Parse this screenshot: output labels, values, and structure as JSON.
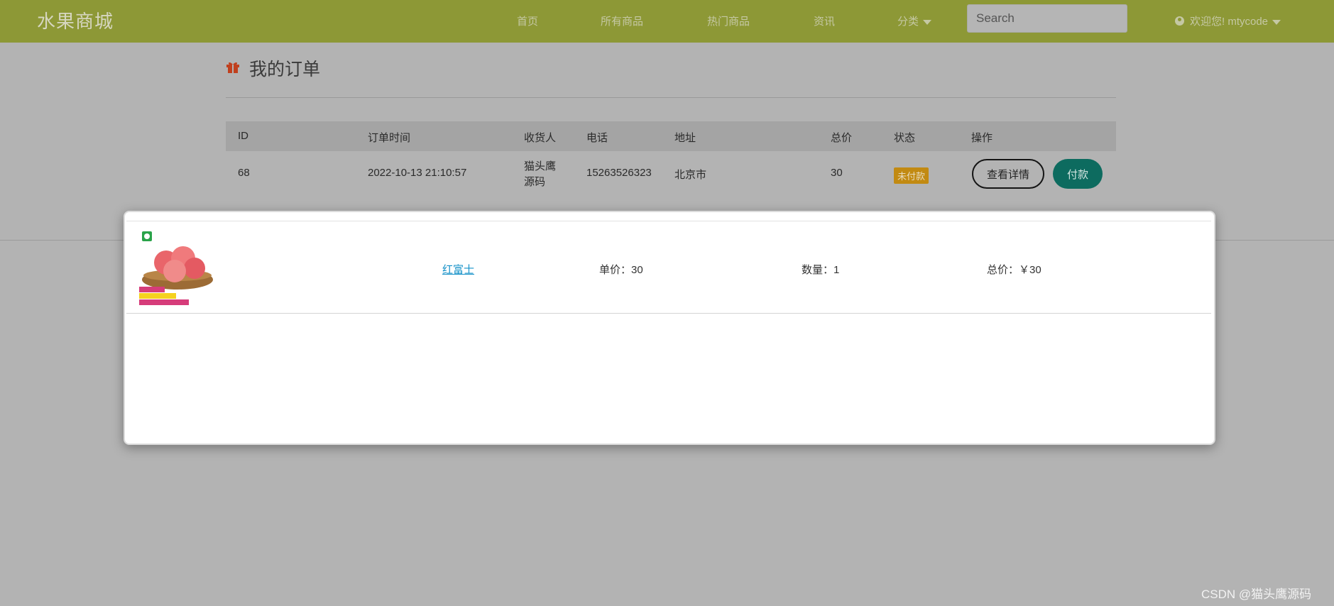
{
  "navbar": {
    "brand": "水果商城",
    "links": [
      "首页",
      "所有商品",
      "热门商品",
      "资讯",
      "分类"
    ],
    "search_placeholder": "Search",
    "user_greeting": "欢迎您! mtycode"
  },
  "page": {
    "title": "我的订单",
    "table": {
      "headers": [
        "ID",
        "订单时间",
        "收货人",
        "电话",
        "地址",
        "总价",
        "状态",
        "操作"
      ],
      "rows": [
        {
          "id": "68",
          "time": "2022-10-13 21:10:57",
          "receiver_line1": "猫头鹰",
          "receiver_line2": "源码",
          "phone": "15263526323",
          "address": "北京市",
          "total": "30",
          "status": "未付款",
          "detail_button": "查看详情",
          "pay_button": "付款"
        }
      ]
    }
  },
  "modal": {
    "items": [
      {
        "name": "红富士",
        "unit_price": "单价：30",
        "quantity": "数量：1",
        "total": "总价：￥30",
        "image_icon": "apple-basket-image"
      }
    ]
  },
  "watermark": "CSDN @猫头鹰源码",
  "colors": {
    "navbar": "#8d9836",
    "overlay": "#b3b3b3",
    "pay_button": "#0d6b5f",
    "status_badge": "#c28a12",
    "link": "#1591c8"
  }
}
